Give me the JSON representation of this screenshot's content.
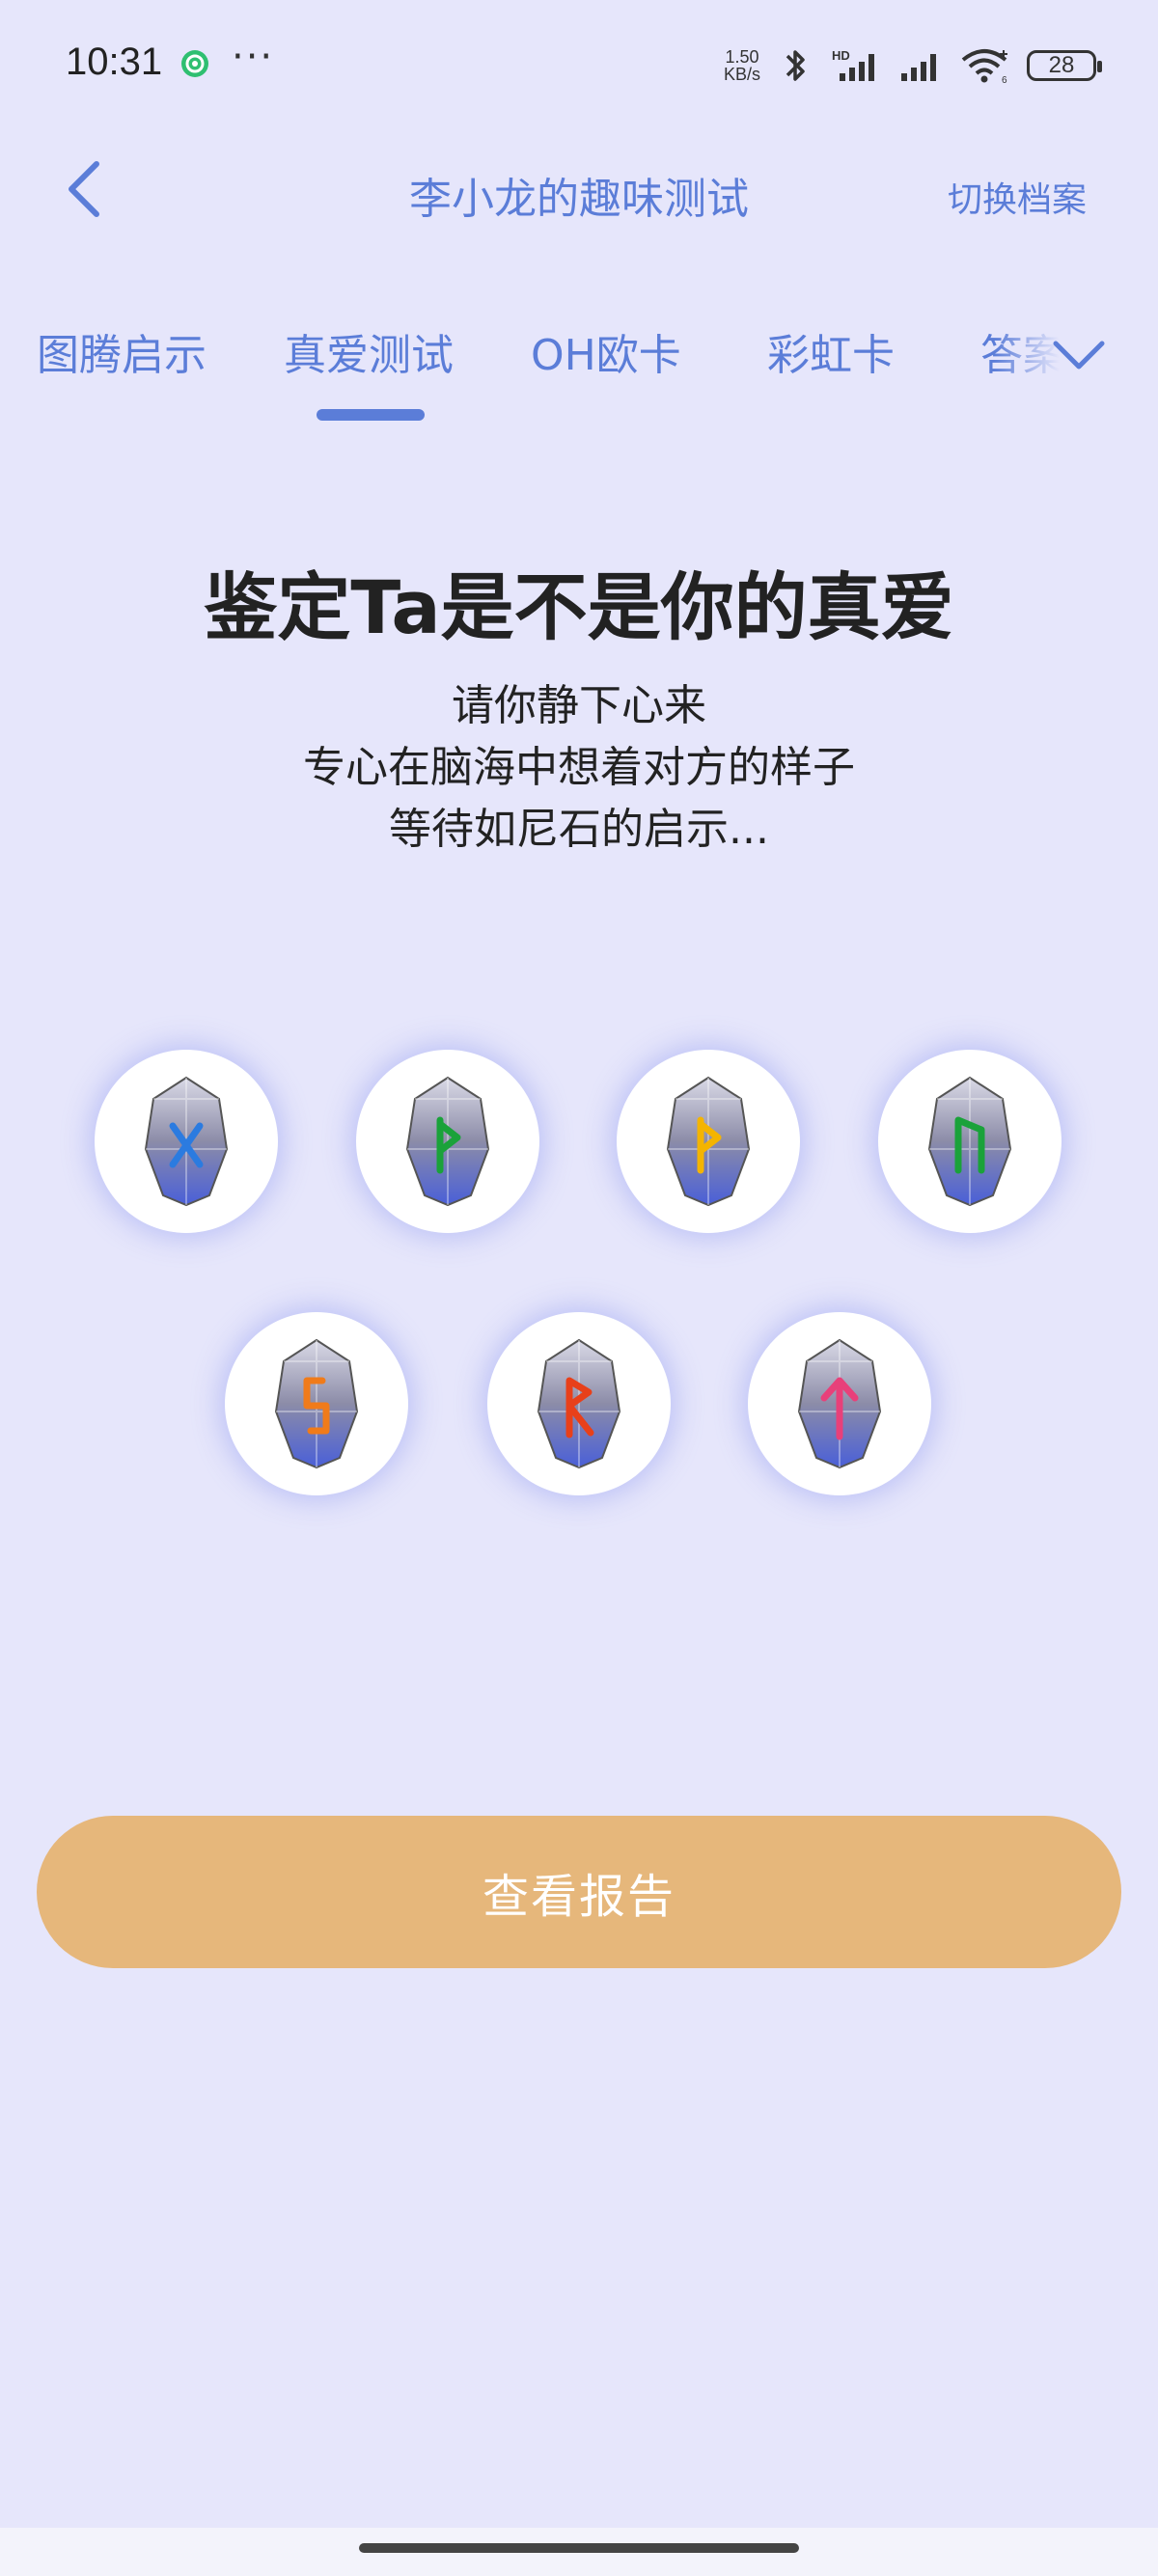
{
  "status_bar": {
    "time": "10:31",
    "more": "···",
    "net_speed_value": "1.50",
    "net_speed_unit": "KB/s",
    "battery": "28",
    "icons": [
      "app-notification-icon",
      "bluetooth-icon",
      "hd-signal-icon",
      "signal-icon",
      "wifi-icon",
      "battery-icon"
    ]
  },
  "header": {
    "title": "李小龙的趣味测试",
    "switch_label": "切换档案"
  },
  "tabs": [
    {
      "label": "图腾启示",
      "active": false
    },
    {
      "label": "真爱测试",
      "active": true
    },
    {
      "label": "OH欧卡",
      "active": false
    },
    {
      "label": "彩虹卡",
      "active": false
    },
    {
      "label": "答案",
      "active": false
    }
  ],
  "main": {
    "headline": "鉴定Ta是不是你的真爱",
    "lines": [
      "请你静下心来",
      "专心在脑海中想着对方的样子",
      "等待如尼石的启示..."
    ]
  },
  "stones": [
    {
      "rune": "gebo-rune-icon",
      "color": "#2b7be0"
    },
    {
      "rune": "wunjo-rune-icon",
      "color": "#1aa23a"
    },
    {
      "rune": "wunjo-rune-icon",
      "color": "#f4b400"
    },
    {
      "rune": "uruz-rune-icon",
      "color": "#1aa23a"
    },
    {
      "rune": "sowilo-rune-icon",
      "color": "#f07b1a"
    },
    {
      "rune": "raido-rune-icon",
      "color": "#e8401a"
    },
    {
      "rune": "tiwaz-rune-icon",
      "color": "#e8407a"
    }
  ],
  "report_button": {
    "label": "查看报告"
  },
  "colors": {
    "background": "#e6e6fb",
    "accent": "#5b7dd8",
    "button": "#e6b77b"
  }
}
